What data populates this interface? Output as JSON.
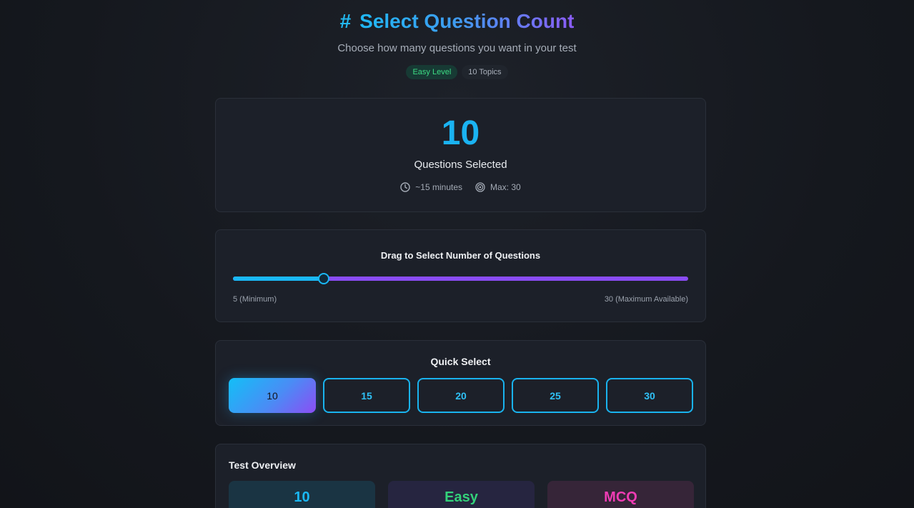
{
  "header": {
    "title_icon": "#",
    "title": "Select Question Count",
    "subtitle": "Choose how many questions you want in your test",
    "badges": {
      "level": "Easy Level",
      "topics": "10 Topics"
    }
  },
  "summary": {
    "count": "10",
    "label": "Questions Selected",
    "duration": "~15 minutes",
    "max": "Max: 30"
  },
  "slider": {
    "title": "Drag to Select Number of Questions",
    "min_label": "5 (Minimum)",
    "max_label": "30 (Maximum Available)",
    "min": 5,
    "max": 30,
    "value": 10
  },
  "quick_select": {
    "title": "Quick Select",
    "options": [
      "10",
      "15",
      "20",
      "25",
      "30"
    ],
    "selected": "10"
  },
  "overview": {
    "title": "Test Overview",
    "tiles": [
      "10",
      "Easy",
      "MCQ"
    ]
  },
  "colors": {
    "accent_blue": "#1ab8f5",
    "accent_purple": "#8a4cf3",
    "easy_green": "#33d17a",
    "mcq_pink": "#f03cb4"
  }
}
